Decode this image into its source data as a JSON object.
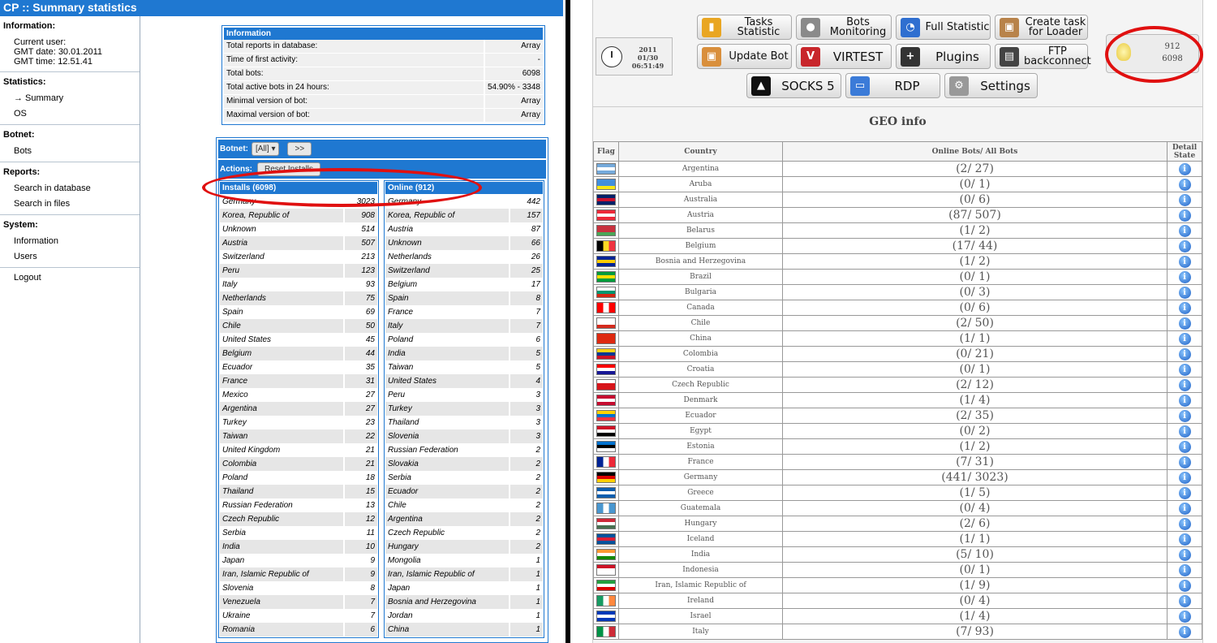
{
  "left": {
    "title": "CP :: Summary statistics",
    "sidebar": {
      "information": {
        "heading": "Information:",
        "current_user": "Current user:",
        "gmt_date": "GMT date: 30.01.2011",
        "gmt_time": "GMT time: 12.51.41"
      },
      "statistics": {
        "heading": "Statistics:",
        "items": [
          "→ Summary",
          "OS"
        ]
      },
      "botnet": {
        "heading": "Botnet:",
        "items": [
          "Bots"
        ]
      },
      "reports": {
        "heading": "Reports:",
        "items": [
          "Search in database",
          "Search in files"
        ]
      },
      "system": {
        "heading": "System:",
        "items": [
          "Information",
          "Users"
        ]
      },
      "logout": "Logout"
    },
    "info_box": {
      "header": "Information",
      "rows": [
        {
          "k": "Total reports in database:",
          "v": "Array"
        },
        {
          "k": "Time of first activity:",
          "v": "-"
        },
        {
          "k": "Total bots:",
          "v": "6098"
        },
        {
          "k": "Total active bots in 24 hours:",
          "v": "54.90% - 3348"
        },
        {
          "k": "Minimal version of bot:",
          "v": "Array"
        },
        {
          "k": "Maximal version of bot:",
          "v": "Array"
        }
      ]
    },
    "botnet_box": {
      "botnet_label": "Botnet:",
      "botnet_select": "[All]",
      "go_button": ">>",
      "actions_label": "Actions:",
      "reset_button": "Reset Installs",
      "installs_header": "Installs (6098)",
      "online_header": "Online (912)",
      "installs": [
        {
          "n": "Germany",
          "c": "3023"
        },
        {
          "n": "Korea, Republic of",
          "c": "908"
        },
        {
          "n": "Unknown",
          "c": "514"
        },
        {
          "n": "Austria",
          "c": "507"
        },
        {
          "n": "Switzerland",
          "c": "213"
        },
        {
          "n": "Peru",
          "c": "123"
        },
        {
          "n": "Italy",
          "c": "93"
        },
        {
          "n": "Netherlands",
          "c": "75"
        },
        {
          "n": "Spain",
          "c": "69"
        },
        {
          "n": "Chile",
          "c": "50"
        },
        {
          "n": "United States",
          "c": "45"
        },
        {
          "n": "Belgium",
          "c": "44"
        },
        {
          "n": "Ecuador",
          "c": "35"
        },
        {
          "n": "France",
          "c": "31"
        },
        {
          "n": "Mexico",
          "c": "27"
        },
        {
          "n": "Argentina",
          "c": "27"
        },
        {
          "n": "Turkey",
          "c": "23"
        },
        {
          "n": "Taiwan",
          "c": "22"
        },
        {
          "n": "United Kingdom",
          "c": "21"
        },
        {
          "n": "Colombia",
          "c": "21"
        },
        {
          "n": "Poland",
          "c": "18"
        },
        {
          "n": "Thailand",
          "c": "15"
        },
        {
          "n": "Russian Federation",
          "c": "13"
        },
        {
          "n": "Czech Republic",
          "c": "12"
        },
        {
          "n": "Serbia",
          "c": "11"
        },
        {
          "n": "India",
          "c": "10"
        },
        {
          "n": "Japan",
          "c": "9"
        },
        {
          "n": "Iran, Islamic Republic of",
          "c": "9"
        },
        {
          "n": "Slovenia",
          "c": "8"
        },
        {
          "n": "Venezuela",
          "c": "7"
        },
        {
          "n": "Ukraine",
          "c": "7"
        },
        {
          "n": "Romania",
          "c": "6"
        }
      ],
      "online": [
        {
          "n": "Germany",
          "c": "442"
        },
        {
          "n": "Korea, Republic of",
          "c": "157"
        },
        {
          "n": "Austria",
          "c": "87"
        },
        {
          "n": "Unknown",
          "c": "66"
        },
        {
          "n": "Netherlands",
          "c": "26"
        },
        {
          "n": "Switzerland",
          "c": "25"
        },
        {
          "n": "Belgium",
          "c": "17"
        },
        {
          "n": "Spain",
          "c": "8"
        },
        {
          "n": "France",
          "c": "7"
        },
        {
          "n": "Italy",
          "c": "7"
        },
        {
          "n": "Poland",
          "c": "6"
        },
        {
          "n": "India",
          "c": "5"
        },
        {
          "n": "Taiwan",
          "c": "5"
        },
        {
          "n": "United States",
          "c": "4"
        },
        {
          "n": "Peru",
          "c": "3"
        },
        {
          "n": "Turkey",
          "c": "3"
        },
        {
          "n": "Thailand",
          "c": "3"
        },
        {
          "n": "Slovenia",
          "c": "3"
        },
        {
          "n": "Russian Federation",
          "c": "2"
        },
        {
          "n": "Slovakia",
          "c": "2"
        },
        {
          "n": "Serbia",
          "c": "2"
        },
        {
          "n": "Ecuador",
          "c": "2"
        },
        {
          "n": "Chile",
          "c": "2"
        },
        {
          "n": "Argentina",
          "c": "2"
        },
        {
          "n": "Czech Republic",
          "c": "2"
        },
        {
          "n": "Hungary",
          "c": "2"
        },
        {
          "n": "Mongolia",
          "c": "1"
        },
        {
          "n": "Iran, Islamic Republic of",
          "c": "1"
        },
        {
          "n": "Japan",
          "c": "1"
        },
        {
          "n": "Bosnia and Herzegovina",
          "c": "1"
        },
        {
          "n": "Jordan",
          "c": "1"
        },
        {
          "n": "China",
          "c": "1"
        }
      ]
    }
  },
  "right": {
    "clock": {
      "year": "2011",
      "date": "01/30",
      "time": "06:51:49"
    },
    "toolbar": [
      {
        "label": "Tasks Statistic",
        "icon": "bar-chart-icon",
        "color": "#e9a623"
      },
      {
        "label": "Bots Monitoring",
        "icon": "users-icon",
        "color": "#8a8a8a"
      },
      {
        "label": "Full Statistic",
        "icon": "pie-chart-icon",
        "color": "#2f6fd0"
      },
      {
        "label": "Create task for Loader",
        "icon": "box-icon",
        "color": "#b8834a"
      },
      {
        "label": "Update Bot",
        "icon": "box-icon",
        "color": "#d98f3c"
      },
      {
        "label": "VIRTEST",
        "icon": "v-icon",
        "color": "#c8262b"
      },
      {
        "label": "Plugins",
        "icon": "plus-icon",
        "color": "#333333"
      },
      {
        "label": "FTP backconnect",
        "icon": "drive-icon",
        "color": "#444444"
      },
      {
        "label": "SOCKS 5",
        "icon": "socks-icon",
        "color": "#111111"
      },
      {
        "label": "RDP",
        "icon": "monitor-icon",
        "color": "#3b7bd8"
      },
      {
        "label": "Settings",
        "icon": "gear-icon",
        "color": "#999999"
      }
    ],
    "counter": {
      "online": "912",
      "all": "6098"
    },
    "geo_title": "GEO info",
    "geo_headers": {
      "flag": "Flag",
      "country": "Country",
      "bots": "Online Bots/ All Bots",
      "detail": "Detail State"
    },
    "geo_rows": [
      {
        "country": "Argentina",
        "bots": "(2/ 27)",
        "flag": [
          "#75aadb",
          "#ffffff",
          "#75aadb"
        ]
      },
      {
        "country": "Aruba",
        "bots": "(0/ 1)",
        "flag": [
          "#418fde",
          "#418fde",
          "#f9e814"
        ]
      },
      {
        "country": "Australia",
        "bots": "(0/ 6)",
        "flag": [
          "#012169",
          "#c8102e",
          "#012169"
        ]
      },
      {
        "country": "Austria",
        "bots": "(87/ 507)",
        "flag": [
          "#ed2939",
          "#ffffff",
          "#ed2939"
        ]
      },
      {
        "country": "Belarus",
        "bots": "(1/ 2)",
        "flag": [
          "#c8313e",
          "#c8313e",
          "#4aa657"
        ]
      },
      {
        "country": "Belgium",
        "bots": "(17/ 44)",
        "flag_v": [
          "#000000",
          "#fdda24",
          "#ef3340"
        ]
      },
      {
        "country": "Bosnia and Herzegovina",
        "bots": "(1/ 2)",
        "flag": [
          "#002395",
          "#fecb00",
          "#002395"
        ]
      },
      {
        "country": "Brazil",
        "bots": "(0/ 1)",
        "flag": [
          "#009c3b",
          "#ffdf00",
          "#009c3b"
        ]
      },
      {
        "country": "Bulgaria",
        "bots": "(0/ 3)",
        "flag": [
          "#ffffff",
          "#00966e",
          "#d62612"
        ]
      },
      {
        "country": "Canada",
        "bots": "(0/ 6)",
        "flag_v": [
          "#ff0000",
          "#ffffff",
          "#ff0000"
        ]
      },
      {
        "country": "Chile",
        "bots": "(2/ 50)",
        "flag": [
          "#ffffff",
          "#ffffff",
          "#d52b1e"
        ]
      },
      {
        "country": "China",
        "bots": "(1/ 1)",
        "flag": [
          "#de2910",
          "#de2910",
          "#de2910"
        ]
      },
      {
        "country": "Colombia",
        "bots": "(0/ 21)",
        "flag": [
          "#fcd116",
          "#003893",
          "#ce1126"
        ]
      },
      {
        "country": "Croatia",
        "bots": "(0/ 1)",
        "flag": [
          "#ff0000",
          "#ffffff",
          "#171796"
        ]
      },
      {
        "country": "Czech Republic",
        "bots": "(2/ 12)",
        "flag": [
          "#ffffff",
          "#d7141a",
          "#d7141a"
        ]
      },
      {
        "country": "Denmark",
        "bots": "(1/ 4)",
        "flag": [
          "#c60c30",
          "#ffffff",
          "#c60c30"
        ]
      },
      {
        "country": "Ecuador",
        "bots": "(2/ 35)",
        "flag": [
          "#ffd100",
          "#0072ce",
          "#ef3340"
        ]
      },
      {
        "country": "Egypt",
        "bots": "(0/ 2)",
        "flag": [
          "#ce1126",
          "#ffffff",
          "#000000"
        ]
      },
      {
        "country": "Estonia",
        "bots": "(1/ 2)",
        "flag": [
          "#0072ce",
          "#000000",
          "#ffffff"
        ]
      },
      {
        "country": "France",
        "bots": "(7/ 31)",
        "flag_v": [
          "#002395",
          "#ffffff",
          "#ed2939"
        ]
      },
      {
        "country": "Germany",
        "bots": "(441/ 3023)",
        "flag": [
          "#000000",
          "#dd0000",
          "#ffce00"
        ]
      },
      {
        "country": "Greece",
        "bots": "(1/ 5)",
        "flag": [
          "#0d5eaf",
          "#ffffff",
          "#0d5eaf"
        ]
      },
      {
        "country": "Guatemala",
        "bots": "(0/ 4)",
        "flag_v": [
          "#4997d0",
          "#ffffff",
          "#4997d0"
        ]
      },
      {
        "country": "Hungary",
        "bots": "(2/ 6)",
        "flag": [
          "#ce2939",
          "#ffffff",
          "#477050"
        ]
      },
      {
        "country": "Iceland",
        "bots": "(1/ 1)",
        "flag": [
          "#02529c",
          "#dc1e35",
          "#02529c"
        ]
      },
      {
        "country": "India",
        "bots": "(5/ 10)",
        "flag": [
          "#ff9933",
          "#ffffff",
          "#138808"
        ]
      },
      {
        "country": "Indonesia",
        "bots": "(0/ 1)",
        "flag": [
          "#ce1126",
          "#ffffff",
          "#ffffff"
        ]
      },
      {
        "country": "Iran, Islamic Republic of",
        "bots": "(1/ 9)",
        "flag": [
          "#239f40",
          "#ffffff",
          "#da0000"
        ]
      },
      {
        "country": "Ireland",
        "bots": "(0/ 4)",
        "flag_v": [
          "#169b62",
          "#ffffff",
          "#ff883e"
        ]
      },
      {
        "country": "Israel",
        "bots": "(1/ 4)",
        "flag": [
          "#0038b8",
          "#ffffff",
          "#0038b8"
        ]
      },
      {
        "country": "Italy",
        "bots": "(7/ 93)",
        "flag_v": [
          "#009246",
          "#ffffff",
          "#ce2b37"
        ]
      }
    ]
  }
}
